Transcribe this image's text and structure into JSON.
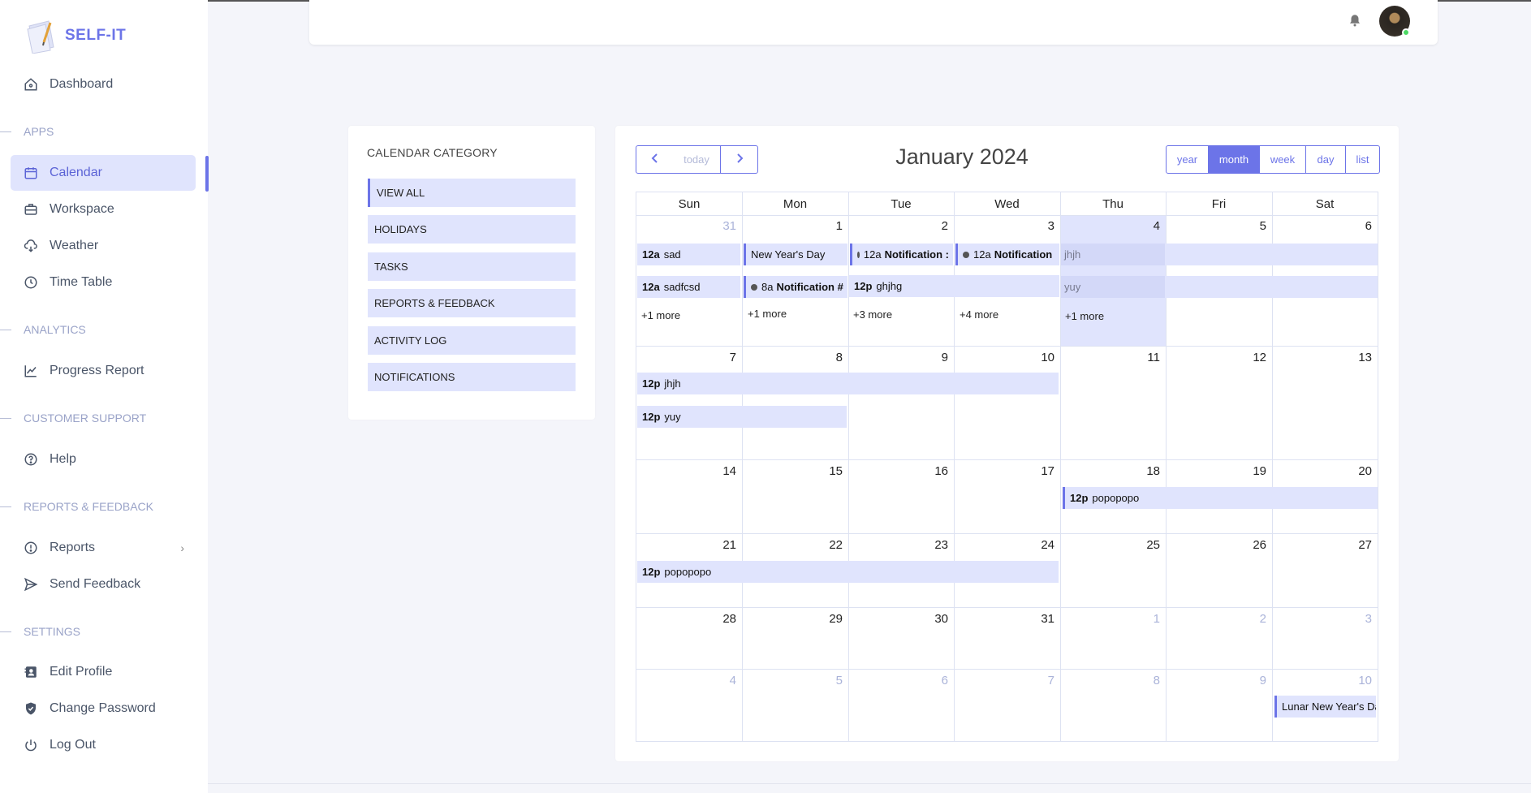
{
  "app": {
    "name": "SELF-IT"
  },
  "sidebar": {
    "items": [
      {
        "label": "Dashboard"
      },
      {
        "section": "APPS"
      },
      {
        "label": "Calendar"
      },
      {
        "label": "Workspace"
      },
      {
        "label": "Weather"
      },
      {
        "label": "Time Table"
      },
      {
        "section": "ANALYTICS"
      },
      {
        "label": "Progress Report"
      },
      {
        "section": "CUSTOMER SUPPORT"
      },
      {
        "label": "Help"
      },
      {
        "section": "REPORTS & FEEDBACK"
      },
      {
        "label": "Reports"
      },
      {
        "label": "Send Feedback"
      },
      {
        "section": "SETTINGS"
      },
      {
        "label": "Edit Profile"
      },
      {
        "label": "Change Password"
      },
      {
        "label": "Log Out"
      }
    ],
    "active": "Calendar"
  },
  "categories": {
    "title": "CALENDAR CATEGORY",
    "items": [
      "VIEW ALL",
      "HOLIDAYS",
      "TASKS",
      "REPORTS & FEEDBACK",
      "ACTIVITY LOG",
      "NOTIFICATIONS"
    ]
  },
  "calendar": {
    "title": "January 2024",
    "today_label": "today",
    "views": [
      "year",
      "month",
      "week",
      "day",
      "list"
    ],
    "active_view": "month",
    "weekdays": [
      "Sun",
      "Mon",
      "Tue",
      "Wed",
      "Thu",
      "Fri",
      "Sat"
    ],
    "weeks": [
      [
        "31",
        "1",
        "2",
        "3",
        "4",
        "5",
        "6"
      ],
      [
        "7",
        "8",
        "9",
        "10",
        "11",
        "12",
        "13"
      ],
      [
        "14",
        "15",
        "16",
        "17",
        "18",
        "19",
        "20"
      ],
      [
        "21",
        "22",
        "23",
        "24",
        "25",
        "26",
        "27"
      ],
      [
        "28",
        "29",
        "30",
        "31",
        "1",
        "2",
        "3"
      ],
      [
        "4",
        "5",
        "6",
        "7",
        "8",
        "9",
        "10"
      ]
    ],
    "events": {
      "e1": {
        "time": "12a",
        "title": "sad"
      },
      "e2": {
        "time": "12a",
        "title": "sadfcsd"
      },
      "e3": {
        "title": "New Year's Day"
      },
      "e4": {
        "time": "8a",
        "title": "Notification #"
      },
      "e5": {
        "time": "12a",
        "title": "Notification :"
      },
      "e6": {
        "time": "12p",
        "title": "ghjhg"
      },
      "e7": {
        "time": "12a",
        "title": "Notification"
      },
      "e8": {
        "title": "jhjh"
      },
      "e9": {
        "title": "yuy"
      },
      "e10": {
        "time": "12p",
        "title": "jhjh"
      },
      "e11": {
        "time": "12p",
        "title": "yuy"
      },
      "e12": {
        "time": "12p",
        "title": "popopopo"
      },
      "e13": {
        "time": "12p",
        "title": "popopopo"
      },
      "e14": {
        "title": "Lunar New Year's Day"
      }
    },
    "more": {
      "sun": "+1 more",
      "mon": "+1 more",
      "tue": "+3 more",
      "wed": "+4 more",
      "thu": "+1 more"
    }
  }
}
